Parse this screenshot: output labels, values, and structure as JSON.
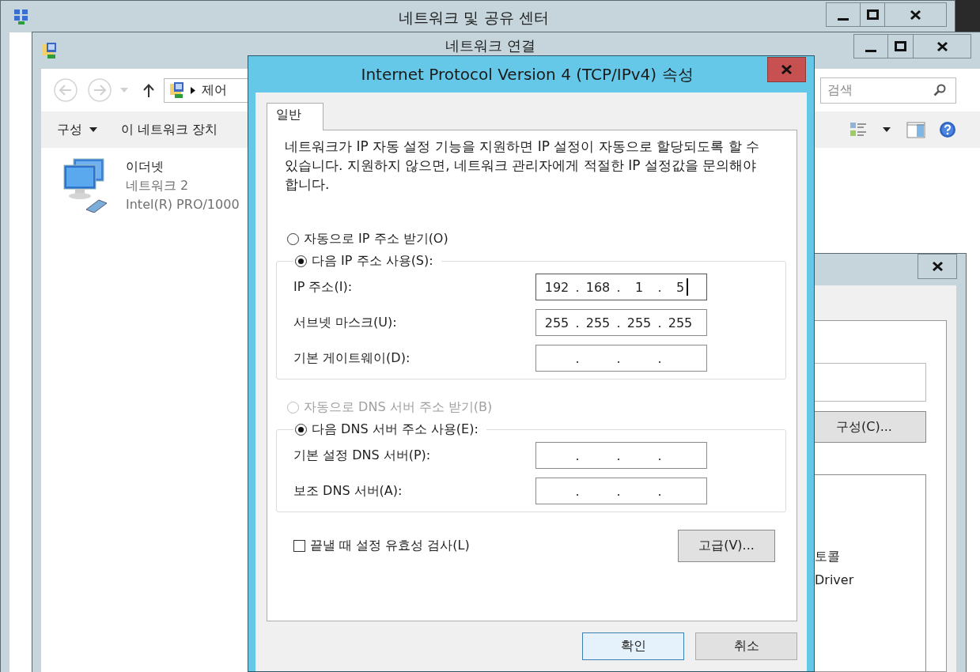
{
  "sharing_window": {
    "title": "네트워크 및 공유 센터"
  },
  "connections_window": {
    "title": "네트워크 연결",
    "address": "제어",
    "search": {
      "placeholder": "검색"
    },
    "toolbar": [
      {
        "label": "구성",
        "menu": true
      },
      {
        "label": "이 네트워크 장치",
        "menu": false
      }
    ],
    "items": [
      {
        "name": "이더넷",
        "lines": [
          "네트워크  2",
          "Intel(R) PRO/1000"
        ]
      }
    ]
  },
  "properties_window": {
    "config_button": "구성(C)...",
    "list_items": [
      "토콜",
      "Driver"
    ]
  },
  "dialog": {
    "title": "Internet Protocol Version 4 (TCP/IPv4) 속성",
    "tabs": [
      {
        "label": "일반",
        "selected": true
      }
    ],
    "description": "네트워크가 IP 자동 설정 기능을 지원하면 IP 설정이 자동으로 할당되도록 할 수 있습니다. 지원하지 않으면, 네트워크 관리자에게 적절한 IP 설정값을 문의해야 합니다.",
    "sections": [
      {
        "auto": {
          "label": "자동으로 IP 주소 받기(O)",
          "selected": false,
          "disabled": false
        },
        "manual": {
          "label": "다음 IP 주소 사용(S):",
          "selected": true,
          "disabled": false
        },
        "fields": [
          {
            "label": "IP 주소(I):",
            "parts": [
              "192",
              ".",
              "168",
              ".",
              "1",
              ".",
              "5"
            ],
            "focused": true
          },
          {
            "label": "서브넷 마스크(U):",
            "parts": [
              "255",
              ".",
              "255",
              ".",
              "255",
              ".",
              "255"
            ],
            "focused": false
          },
          {
            "label": "기본 게이트웨이(D):",
            "parts": [
              ".",
              ".",
              "."
            ],
            "focused": false
          }
        ]
      },
      {
        "auto": {
          "label": "자동으로 DNS 서버 주소 받기(B)",
          "selected": false,
          "disabled": true
        },
        "manual": {
          "label": "다음 DNS 서버 주소 사용(E):",
          "selected": true,
          "disabled": false
        },
        "fields": [
          {
            "label": "기본 설정 DNS 서버(P):",
            "parts": [
              ".",
              ".",
              "."
            ],
            "focused": false
          },
          {
            "label": "보조 DNS 서버(A):",
            "parts": [
              ".",
              ".",
              "."
            ],
            "focused": false
          }
        ]
      }
    ],
    "validate": {
      "label": "끝낼 때 설정 유효성 검사(L)",
      "checked": false
    },
    "advanced_button": "고급(V)...",
    "buttons": [
      {
        "label": "확인",
        "default": true
      },
      {
        "label": "취소",
        "default": false
      }
    ]
  }
}
